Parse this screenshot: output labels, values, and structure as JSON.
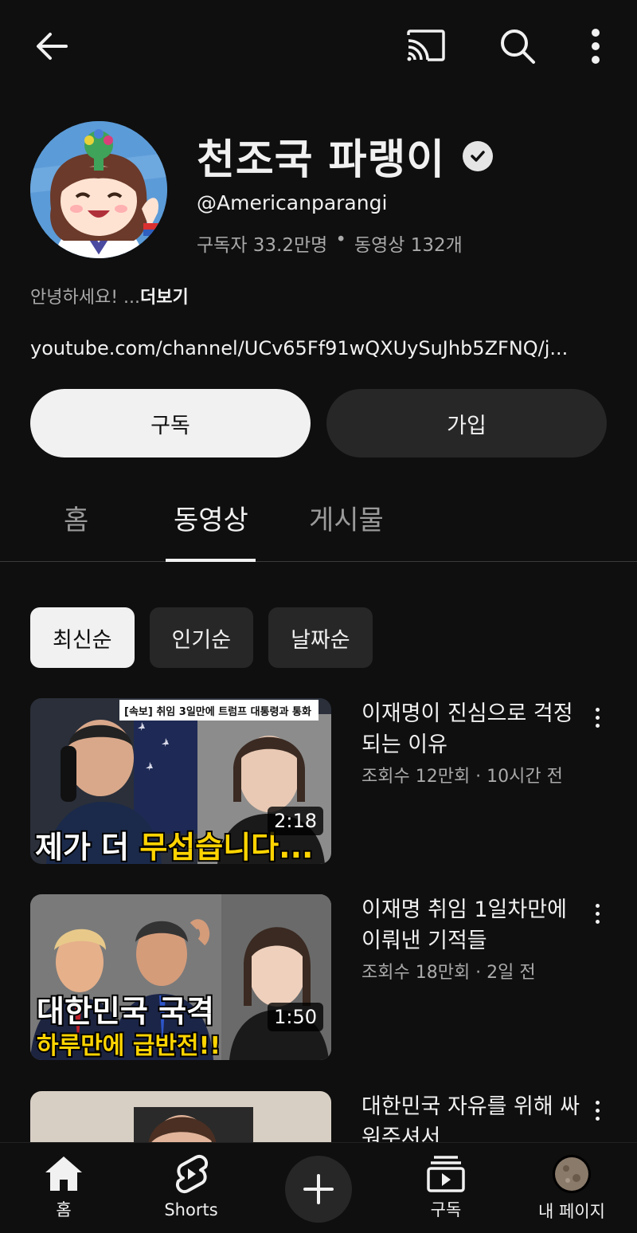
{
  "channel": {
    "name": "천조국 파랭이",
    "handle": "@Americanparangi",
    "subscribers": "구독자 33.2만명",
    "separator": "•",
    "video_count": "동영상 132개",
    "description": "안녕하세요! ...",
    "description_more": "더보기",
    "link": "youtube.com/channel/UCv65Ff91wQXUySuJhb5ZFNQ/j..."
  },
  "actions": {
    "subscribe_label": "구독",
    "join_label": "가입"
  },
  "tabs": [
    {
      "label": "홈",
      "active": false
    },
    {
      "label": "동영상",
      "active": true
    },
    {
      "label": "게시물",
      "active": false
    }
  ],
  "chips": [
    {
      "label": "최신순",
      "active": true
    },
    {
      "label": "인기순",
      "active": false
    },
    {
      "label": "날짜순",
      "active": false
    }
  ],
  "videos": [
    {
      "title": "이재명이 진심으로 걱정되는 이유",
      "meta": "조회수 12만회 · 10시간 전",
      "duration": "2:18",
      "thumb_tag": "[속보] 취임 3일만에 트럼프 대통령과 통화",
      "thumb_caption_white": "제가 더 ",
      "thumb_caption_yellow": "무섭습니다..."
    },
    {
      "title": "이재명 취임 1일차만에 이뤄낸 기적들",
      "meta": "조회수 18만회 · 2일 전",
      "duration": "1:50",
      "thumb_caption_line1": "대한민국 국격",
      "thumb_caption_line2": "하루만에 급반전!!"
    },
    {
      "title": "대한민국 자유를 위해 싸워주셔서"
    }
  ],
  "bottom_nav": {
    "home": "홈",
    "shorts": "Shorts",
    "subscriptions": "구독",
    "you": "내 페이지"
  },
  "colors": {
    "background": "#0f0f0f",
    "surface": "#272727",
    "text": "#f1f1f1",
    "secondary_text": "#aaaaaa",
    "thumb_highlight": "#ffd400"
  }
}
